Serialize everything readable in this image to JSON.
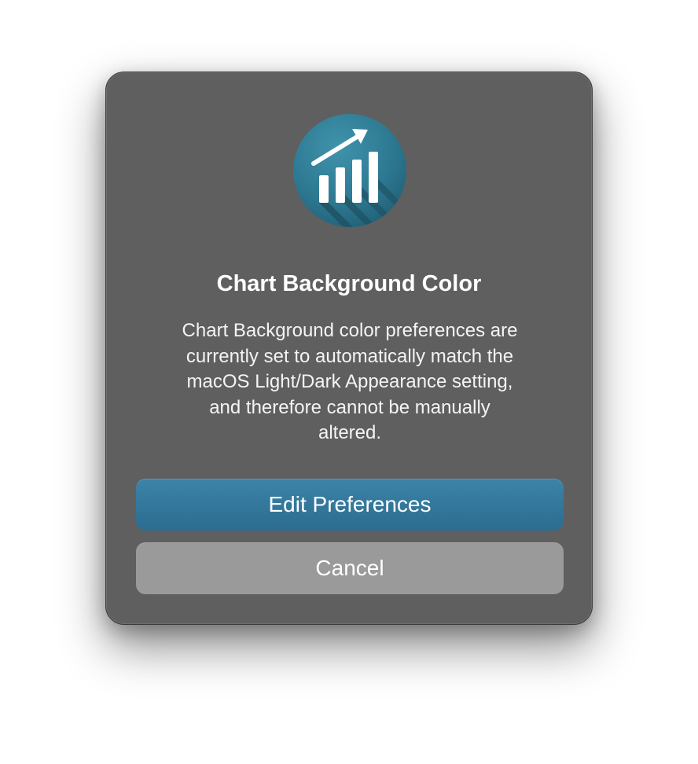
{
  "dialog": {
    "title": "Chart Background Color",
    "message": "Chart Background color preferences are\ncurrently set to automatically match the\nmacOS Light/Dark Appearance setting,\nand therefore cannot be manually\naltered.",
    "primary_button": "Edit Preferences",
    "secondary_button": "Cancel",
    "app_icon": "chart-growth-icon"
  },
  "colors": {
    "dialog_background": "#5f5f5f",
    "primary_button": "#326f92",
    "secondary_button": "#9a9a9a",
    "icon_circle": "#2f7e97",
    "text": "#ffffff"
  }
}
